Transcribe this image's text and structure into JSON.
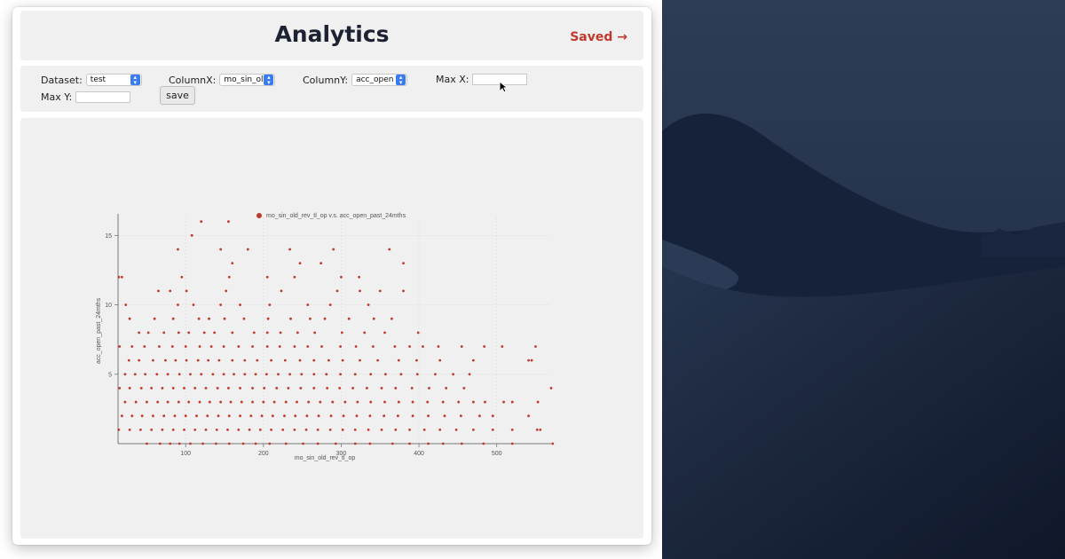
{
  "header": {
    "title": "Analytics",
    "saved_link": "Saved →"
  },
  "controls": {
    "dataset_label": "Dataset:",
    "dataset_value": "test",
    "columnx_label": "ColumnX:",
    "columnx_value": "mo_sin_ol",
    "columny_label": "ColumnY:",
    "columny_value": "acc_open",
    "maxx_label": "Max X:",
    "maxx_value": "",
    "maxy_label": "Max Y:",
    "maxy_value": "",
    "save_label": "save"
  },
  "colors": {
    "accent": "#c0392b",
    "point": "#c0392b",
    "title": "#1d2233"
  },
  "chart_data": {
    "type": "scatter",
    "legend": "mo_sin_old_rev_tl_op v.s. acc_open_past_24mths",
    "legend_position": "top",
    "xlabel": "mo_sin_old_rev_tl_op",
    "ylabel": "acc_open_past_24mths",
    "xlim": [
      13,
      570
    ],
    "ylim": [
      0,
      16.3
    ],
    "xticks": [
      100,
      200,
      300,
      400,
      500
    ],
    "yticks": [
      5,
      10,
      15
    ],
    "grid": true,
    "series": [
      {
        "points": [
          [
            120,
            16
          ],
          [
            155,
            16
          ],
          [
            108,
            15
          ],
          [
            14,
            12
          ],
          [
            90,
            14
          ],
          [
            145,
            14
          ],
          [
            180,
            14
          ],
          [
            234,
            14
          ],
          [
            290,
            14
          ],
          [
            362,
            14
          ],
          [
            160,
            13
          ],
          [
            247,
            13
          ],
          [
            274,
            13
          ],
          [
            380,
            13
          ],
          [
            18,
            12
          ],
          [
            95,
            12
          ],
          [
            156,
            12
          ],
          [
            205,
            12
          ],
          [
            240,
            12
          ],
          [
            300,
            12
          ],
          [
            323,
            12
          ],
          [
            65,
            11
          ],
          [
            80,
            11
          ],
          [
            101,
            11
          ],
          [
            152,
            11
          ],
          [
            223,
            11
          ],
          [
            295,
            11
          ],
          [
            324,
            11
          ],
          [
            350,
            11
          ],
          [
            380,
            11
          ],
          [
            23,
            10
          ],
          [
            90,
            10
          ],
          [
            110,
            10
          ],
          [
            145,
            10
          ],
          [
            170,
            10
          ],
          [
            208,
            10
          ],
          [
            257,
            10
          ],
          [
            286,
            10
          ],
          [
            335,
            10
          ],
          [
            28,
            9
          ],
          [
            60,
            9
          ],
          [
            84,
            9
          ],
          [
            117,
            9
          ],
          [
            130,
            9
          ],
          [
            150,
            9
          ],
          [
            175,
            9
          ],
          [
            206,
            9
          ],
          [
            235,
            9
          ],
          [
            260,
            9
          ],
          [
            279,
            9
          ],
          [
            310,
            9
          ],
          [
            342,
            9
          ],
          [
            365,
            9
          ],
          [
            40,
            8
          ],
          [
            52,
            8
          ],
          [
            72,
            8
          ],
          [
            91,
            8
          ],
          [
            104,
            8
          ],
          [
            124,
            8
          ],
          [
            137,
            8
          ],
          [
            160,
            8
          ],
          [
            188,
            8
          ],
          [
            205,
            8
          ],
          [
            222,
            8
          ],
          [
            244,
            8
          ],
          [
            266,
            8
          ],
          [
            301,
            8
          ],
          [
            330,
            8
          ],
          [
            356,
            8
          ],
          [
            399,
            8
          ],
          [
            15,
            7
          ],
          [
            31,
            7
          ],
          [
            47,
            7
          ],
          [
            66,
            7
          ],
          [
            83,
            7
          ],
          [
            100,
            7
          ],
          [
            118,
            7
          ],
          [
            133,
            7
          ],
          [
            149,
            7
          ],
          [
            168,
            7
          ],
          [
            186,
            7
          ],
          [
            205,
            7
          ],
          [
            221,
            7
          ],
          [
            240,
            7
          ],
          [
            257,
            7
          ],
          [
            275,
            7
          ],
          [
            299,
            7
          ],
          [
            319,
            7
          ],
          [
            341,
            7
          ],
          [
            369,
            7
          ],
          [
            388,
            7
          ],
          [
            405,
            7
          ],
          [
            425,
            7
          ],
          [
            455,
            7
          ],
          [
            484,
            7
          ],
          [
            507,
            7
          ],
          [
            550,
            7
          ],
          [
            27,
            6
          ],
          [
            40,
            6
          ],
          [
            58,
            6
          ],
          [
            74,
            6
          ],
          [
            87,
            6
          ],
          [
            101,
            6
          ],
          [
            116,
            6
          ],
          [
            129,
            6
          ],
          [
            143,
            6
          ],
          [
            160,
            6
          ],
          [
            176,
            6
          ],
          [
            192,
            6
          ],
          [
            210,
            6
          ],
          [
            228,
            6
          ],
          [
            247,
            6
          ],
          [
            265,
            6
          ],
          [
            284,
            6
          ],
          [
            302,
            6
          ],
          [
            324,
            6
          ],
          [
            347,
            6
          ],
          [
            374,
            6
          ],
          [
            397,
            6
          ],
          [
            427,
            6
          ],
          [
            470,
            6
          ],
          [
            541,
            6
          ],
          [
            545,
            6
          ],
          [
            22,
            5
          ],
          [
            35,
            5
          ],
          [
            48,
            5
          ],
          [
            63,
            5
          ],
          [
            77,
            5
          ],
          [
            92,
            5
          ],
          [
            106,
            5
          ],
          [
            120,
            5
          ],
          [
            135,
            5
          ],
          [
            149,
            5
          ],
          [
            162,
            5
          ],
          [
            176,
            5
          ],
          [
            190,
            5
          ],
          [
            204,
            5
          ],
          [
            219,
            5
          ],
          [
            234,
            5
          ],
          [
            249,
            5
          ],
          [
            265,
            5
          ],
          [
            281,
            5
          ],
          [
            299,
            5
          ],
          [
            318,
            5
          ],
          [
            338,
            5
          ],
          [
            357,
            5
          ],
          [
            377,
            5
          ],
          [
            398,
            5
          ],
          [
            421,
            5
          ],
          [
            444,
            5
          ],
          [
            465,
            5
          ],
          [
            15,
            4
          ],
          [
            28,
            4
          ],
          [
            43,
            4
          ],
          [
            56,
            4
          ],
          [
            70,
            4
          ],
          [
            84,
            4
          ],
          [
            98,
            4
          ],
          [
            112,
            4
          ],
          [
            126,
            4
          ],
          [
            141,
            4
          ],
          [
            155,
            4
          ],
          [
            170,
            4
          ],
          [
            186,
            4
          ],
          [
            201,
            4
          ],
          [
            217,
            4
          ],
          [
            232,
            4
          ],
          [
            248,
            4
          ],
          [
            265,
            4
          ],
          [
            282,
            4
          ],
          [
            298,
            4
          ],
          [
            315,
            4
          ],
          [
            333,
            4
          ],
          [
            352,
            4
          ],
          [
            370,
            4
          ],
          [
            391,
            4
          ],
          [
            413,
            4
          ],
          [
            435,
            4
          ],
          [
            458,
            4
          ],
          [
            570,
            4
          ],
          [
            22,
            3
          ],
          [
            36,
            3
          ],
          [
            50,
            3
          ],
          [
            64,
            3
          ],
          [
            77,
            3
          ],
          [
            91,
            3
          ],
          [
            104,
            3
          ],
          [
            118,
            3
          ],
          [
            131,
            3
          ],
          [
            145,
            3
          ],
          [
            158,
            3
          ],
          [
            172,
            3
          ],
          [
            186,
            3
          ],
          [
            200,
            3
          ],
          [
            214,
            3
          ],
          [
            229,
            3
          ],
          [
            243,
            3
          ],
          [
            258,
            3
          ],
          [
            273,
            3
          ],
          [
            289,
            3
          ],
          [
            305,
            3
          ],
          [
            321,
            3
          ],
          [
            338,
            3
          ],
          [
            356,
            3
          ],
          [
            374,
            3
          ],
          [
            392,
            3
          ],
          [
            411,
            3
          ],
          [
            431,
            3
          ],
          [
            451,
            3
          ],
          [
            470,
            3
          ],
          [
            485,
            3
          ],
          [
            509,
            3
          ],
          [
            520,
            3
          ],
          [
            553,
            3
          ],
          [
            599,
            3
          ],
          [
            18,
            2
          ],
          [
            31,
            2
          ],
          [
            44,
            2
          ],
          [
            58,
            2
          ],
          [
            72,
            2
          ],
          [
            86,
            2
          ],
          [
            100,
            2
          ],
          [
            114,
            2
          ],
          [
            128,
            2
          ],
          [
            142,
            2
          ],
          [
            156,
            2
          ],
          [
            170,
            2
          ],
          [
            184,
            2
          ],
          [
            198,
            2
          ],
          [
            212,
            2
          ],
          [
            227,
            2
          ],
          [
            241,
            2
          ],
          [
            256,
            2
          ],
          [
            271,
            2
          ],
          [
            287,
            2
          ],
          [
            303,
            2
          ],
          [
            320,
            2
          ],
          [
            337,
            2
          ],
          [
            355,
            2
          ],
          [
            373,
            2
          ],
          [
            392,
            2
          ],
          [
            412,
            2
          ],
          [
            433,
            2
          ],
          [
            454,
            2
          ],
          [
            478,
            2
          ],
          [
            495,
            2
          ],
          [
            541,
            2
          ],
          [
            14,
            1
          ],
          [
            28,
            1
          ],
          [
            42,
            1
          ],
          [
            56,
            1
          ],
          [
            70,
            1
          ],
          [
            84,
            1
          ],
          [
            98,
            1
          ],
          [
            112,
            1
          ],
          [
            126,
            1
          ],
          [
            140,
            1
          ],
          [
            154,
            1
          ],
          [
            168,
            1
          ],
          [
            182,
            1
          ],
          [
            196,
            1
          ],
          [
            210,
            1
          ],
          [
            225,
            1
          ],
          [
            240,
            1
          ],
          [
            255,
            1
          ],
          [
            270,
            1
          ],
          [
            286,
            1
          ],
          [
            302,
            1
          ],
          [
            318,
            1
          ],
          [
            335,
            1
          ],
          [
            352,
            1
          ],
          [
            370,
            1
          ],
          [
            388,
            1
          ],
          [
            407,
            1
          ],
          [
            427,
            1
          ],
          [
            448,
            1
          ],
          [
            470,
            1
          ],
          [
            495,
            1
          ],
          [
            520,
            1
          ],
          [
            552,
            1
          ],
          [
            556,
            1
          ],
          [
            612,
            1
          ],
          [
            617,
            1
          ],
          [
            50,
            0
          ],
          [
            67,
            0
          ],
          [
            80,
            0
          ],
          [
            92,
            0
          ],
          [
            106,
            0
          ],
          [
            122,
            0
          ],
          [
            139,
            0
          ],
          [
            156,
            0
          ],
          [
            174,
            0
          ],
          [
            190,
            0
          ],
          [
            208,
            0
          ],
          [
            229,
            0
          ],
          [
            251,
            0
          ],
          [
            270,
            0
          ],
          [
            293,
            0
          ],
          [
            318,
            0
          ],
          [
            337,
            0
          ],
          [
            366,
            0
          ],
          [
            388,
            0
          ],
          [
            412,
            0
          ],
          [
            431,
            0
          ],
          [
            455,
            0
          ],
          [
            483,
            0
          ],
          [
            520,
            0
          ],
          [
            572,
            0
          ]
        ]
      }
    ]
  }
}
